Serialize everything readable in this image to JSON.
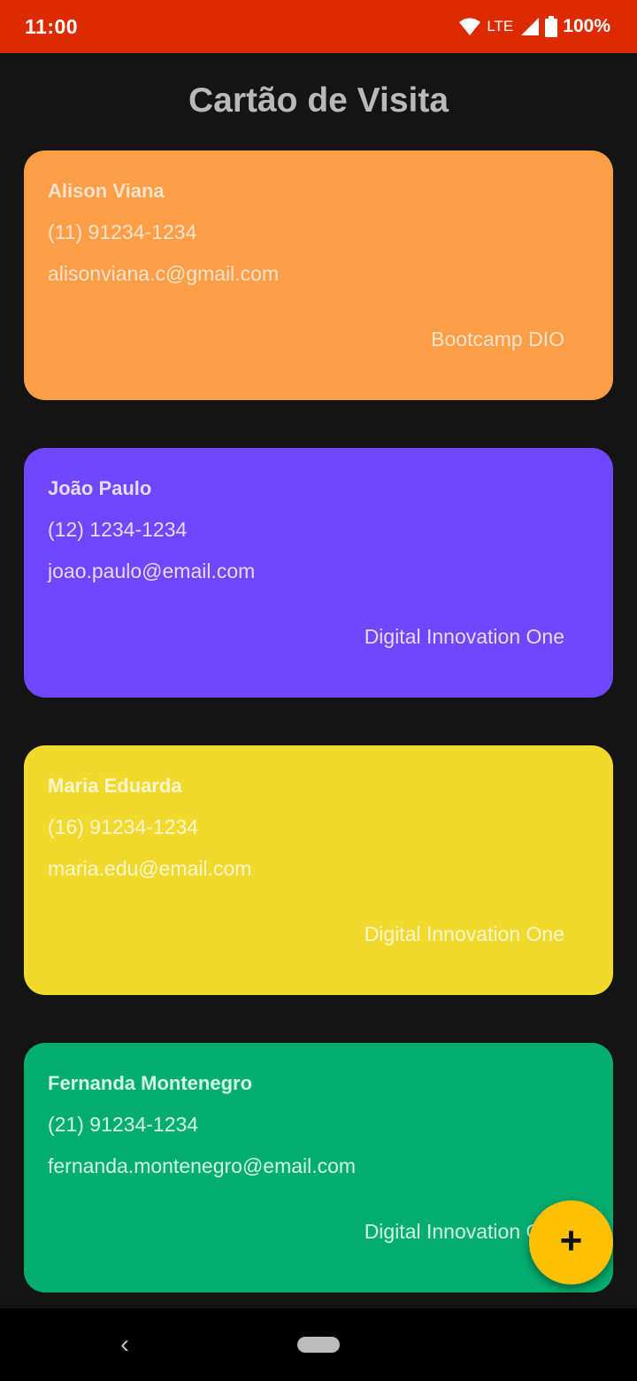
{
  "status_bar": {
    "time": "11:00",
    "network": "LTE",
    "battery": "100%",
    "color": "#dc2b00"
  },
  "title": "Cartão de Visita",
  "cards": [
    {
      "name": "Alison Viana",
      "phone": "(11) 91234-1234",
      "email": "alisonviana.c@gmail.com",
      "company": "Bootcamp DIO",
      "background": "#fe9e47"
    },
    {
      "name": "João Paulo",
      "phone": "(12) 1234-1234",
      "email": "joao.paulo@email.com",
      "company": "Digital Innovation One",
      "background": "#7046fe"
    },
    {
      "name": "Maria Eduarda",
      "phone": "(16) 91234-1234",
      "email": "maria.edu@email.com",
      "company": "Digital Innovation One",
      "background": "#f1d92d"
    },
    {
      "name": "Fernanda Montenegro",
      "phone": "(21) 91234-1234",
      "email": "fernanda.montenegro@email.com",
      "company": "Digital Innovation One",
      "background": "#03ad6f"
    }
  ],
  "fab": {
    "icon": "plus-icon",
    "label": "+",
    "color": "#fcc005"
  },
  "nav_bar": {
    "back_icon": "back-icon",
    "back_glyph": "‹",
    "home_icon": "home-pill-icon"
  }
}
